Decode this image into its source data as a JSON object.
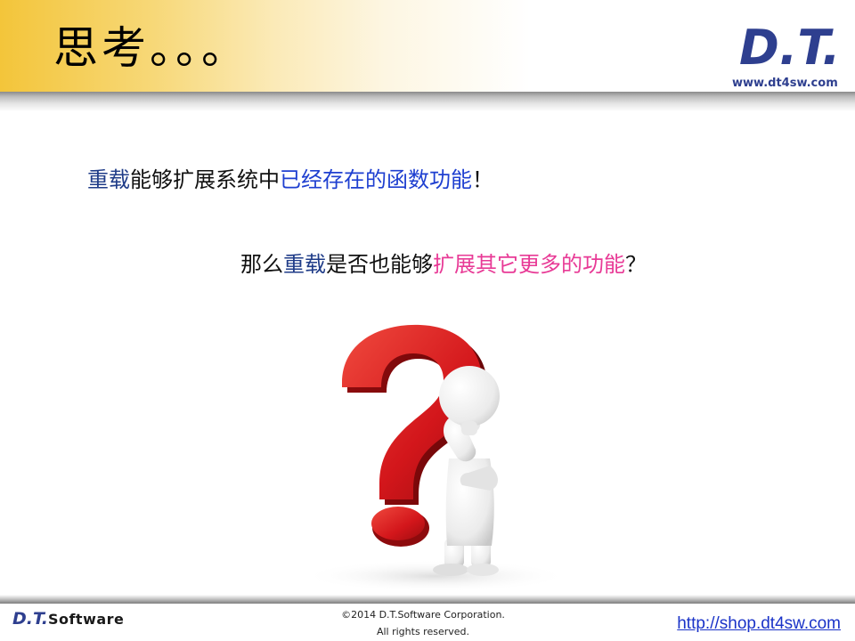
{
  "header": {
    "title": "思考。。。",
    "logo_text": "D.T.",
    "logo_url": "www.dt4sw.com"
  },
  "body": {
    "line1": {
      "part1": "重载",
      "part2": "能够扩展系统中",
      "part3": "已经存在的函数功能",
      "part4": "！"
    },
    "line2": {
      "part1": "那么",
      "part2": "重载",
      "part3": "是否也能够",
      "part4": "扩展其它更多的功能",
      "part5": "？"
    }
  },
  "footer": {
    "brand_prefix": "D.T.",
    "brand_suffix": "Software",
    "copyright_line1": "©2014 D.T.Software Corporation.",
    "copyright_line2": "All rights reserved.",
    "url": "http://shop.dt4sw.com"
  },
  "colors": {
    "accent_blue": "#1e3fd0",
    "accent_pink": "#e83a96",
    "header_gold": "#f3c53a"
  },
  "icons": [
    "dt-logo",
    "question-mark-figure-image"
  ]
}
